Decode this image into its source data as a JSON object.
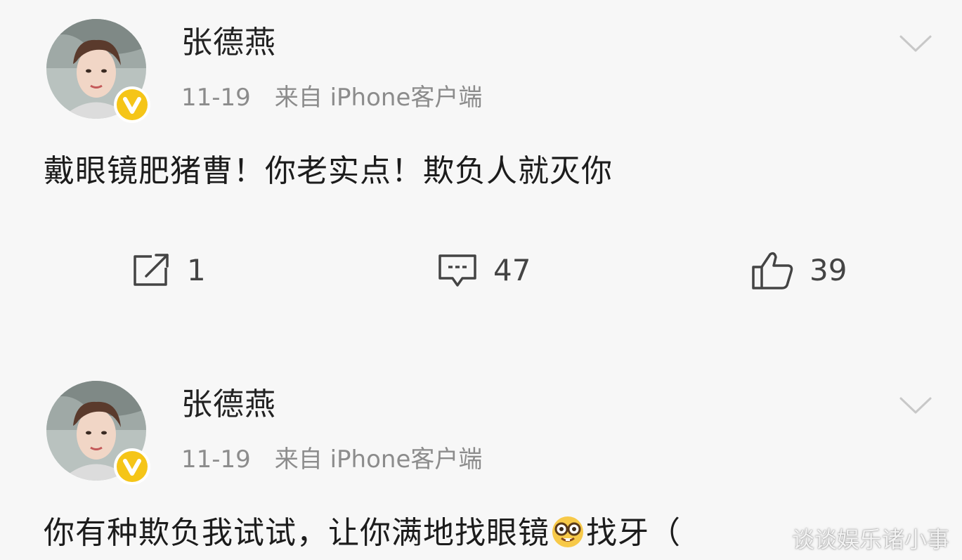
{
  "posts": [
    {
      "username": "张德燕",
      "date": "11-19",
      "source": "来自 iPhone客户端",
      "content": "戴眼镜肥猪曹！你老实点！欺负人就灭你",
      "actions": {
        "repost_count": "1",
        "comment_count": "47",
        "like_count": "39"
      }
    },
    {
      "username": "张德燕",
      "date": "11-19",
      "source": "来自 iPhone客户端",
      "content_before_emoji": "你有种欺负我试试，让你满地找眼镜",
      "content_after_emoji": "找牙（",
      "emoji": "nerd-face-emoji"
    }
  ],
  "watermark": "谈谈娱乐诸小事",
  "colors": {
    "background": "#f7f7f7",
    "verified_badge": "#f5c518",
    "meta_text": "#8c8c8c",
    "icon_stroke": "#444444"
  },
  "icons": {
    "repost": "share-icon",
    "comment": "comment-icon",
    "like": "thumbs-up-icon",
    "more": "chevron-down-icon",
    "verified": "verified-v-badge"
  }
}
